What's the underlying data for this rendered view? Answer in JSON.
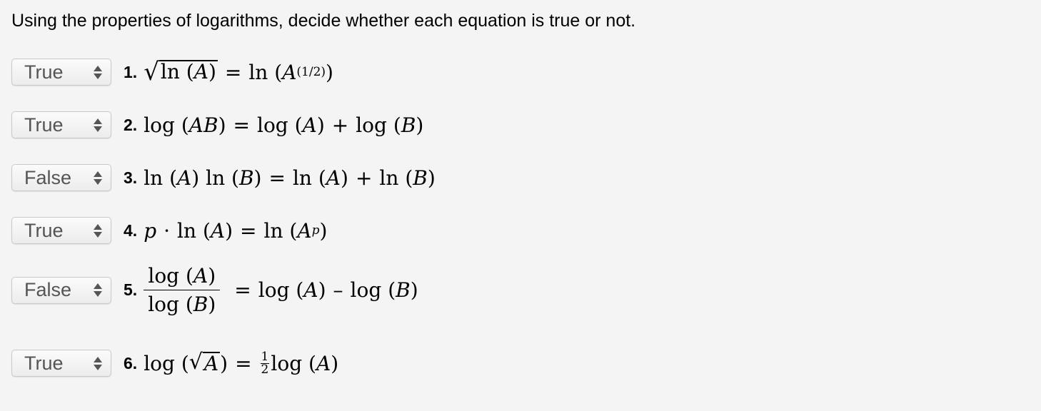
{
  "instruction": "Using the properties of logarithms, decide whether each equation is true or not.",
  "rows": [
    {
      "answer": "True",
      "number": "1."
    },
    {
      "answer": "True",
      "number": "2."
    },
    {
      "answer": "False",
      "number": "3."
    },
    {
      "answer": "True",
      "number": "4."
    },
    {
      "answer": "False",
      "number": "5."
    },
    {
      "answer": "True",
      "number": "6."
    }
  ],
  "math": {
    "ln": "ln",
    "log": "log",
    "A": "A",
    "B": "B",
    "AB": "AB",
    "p": "p",
    "eq": "=",
    "plus": "+",
    "minus": "–",
    "cdot": "·",
    "lp": "(",
    "rp": ")",
    "half_exp": "(1/2)",
    "half_num": "1",
    "half_den": "2"
  }
}
